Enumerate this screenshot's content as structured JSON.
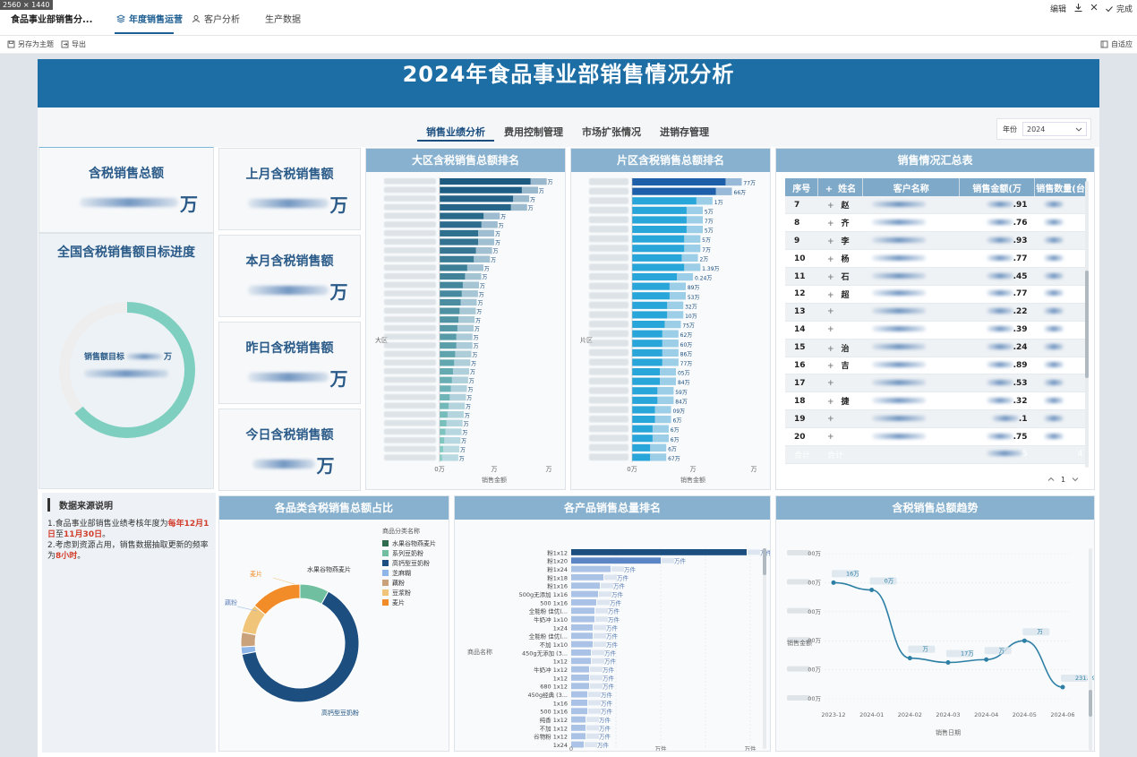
{
  "dim_tag": "2560 × 1440",
  "app_title": "食品事业部销售分...",
  "top_tabs": [
    {
      "label": "年度销售运营",
      "icon": "layers-icon",
      "active": true
    },
    {
      "label": "客户分析",
      "icon": "user-icon",
      "active": false
    },
    {
      "label": "生产数据",
      "icon": "",
      "active": false
    }
  ],
  "top_right": {
    "edit_label": "编辑",
    "finish_label": "完成"
  },
  "toolbar": {
    "save_as_label": "另存为主题",
    "export_label": "导出",
    "fit_label": "自适应"
  },
  "dashboard": {
    "title": "2024年食品事业部销售情况分析",
    "sub_tabs": [
      "销售业绩分析",
      "费用控制管理",
      "市场扩张情况",
      "进销存管理"
    ],
    "active_sub_tab": 0,
    "year_filter": {
      "label": "年份",
      "value": "2024"
    },
    "kpis": {
      "total": {
        "title": "含税销售总额",
        "unit": "万"
      },
      "last_month": {
        "title": "上月含税销售额",
        "unit": "万"
      },
      "this_month": {
        "title": "本月含税销售额",
        "unit": "万"
      },
      "yesterday": {
        "title": "昨日含税销售额",
        "unit": "万"
      },
      "today": {
        "title": "今日含税销售额",
        "unit": "万"
      }
    },
    "target_progress": {
      "title": "全国含税销售额目标进度",
      "center_label": "销售额目标",
      "center_unit": "万",
      "fraction": 0.64
    },
    "data_source": {
      "title": "数据来源说明",
      "line1_a": "1.食品事业部销售业绩考核年度为",
      "line1_b": "每年12月1日",
      "line1_c": "至",
      "line1_d": "11月30日",
      "line1_e": "。",
      "line2_a": "2.考虑到资源占用，销售数据抽取更新的频率为",
      "line2_b": "8小时",
      "line2_c": "。"
    },
    "region_rank": {
      "title": "大区含税销售总额排名",
      "axis_label": "大区",
      "xlabel": "销售金额",
      "tick_first": "0万",
      "tick_mid": "万",
      "tick_last": "万",
      "row_suffix": "大区",
      "value_unit": "万",
      "fractions": [
        0.98,
        0.9,
        0.82,
        0.8,
        0.55,
        0.53,
        0.5,
        0.5,
        0.48,
        0.46,
        0.4,
        0.38,
        0.36,
        0.35,
        0.34,
        0.33,
        0.32,
        0.31,
        0.3,
        0.3,
        0.29,
        0.28,
        0.27,
        0.26,
        0.25,
        0.24,
        0.23,
        0.22,
        0.21,
        0.2,
        0.19,
        0.18,
        0.17
      ]
    },
    "district_rank": {
      "title": "片区含税销售总额排名",
      "axis_label": "片区",
      "xlabel": "销售金额",
      "tick_first": "0万",
      "tick_mid": "万",
      "tick_last": "万",
      "value_labels": [
        "77万",
        "66万",
        "1万",
        "5万",
        "7万",
        "5万",
        "5万",
        "7万",
        "2万",
        "1.39万",
        "0.24万",
        "89万",
        "53万",
        "32万",
        "10万",
        "75万",
        "62万",
        "60万",
        "86万",
        "77万",
        "05万",
        "84万",
        "59万",
        "84万",
        "09万",
        "6万",
        "6万",
        "6万",
        "6万",
        "67万"
      ],
      "fractions": [
        0.9,
        0.82,
        0.66,
        0.58,
        0.58,
        0.58,
        0.56,
        0.56,
        0.54,
        0.56,
        0.5,
        0.44,
        0.44,
        0.42,
        0.42,
        0.4,
        0.38,
        0.38,
        0.38,
        0.38,
        0.36,
        0.36,
        0.34,
        0.34,
        0.32,
        0.32,
        0.3,
        0.3,
        0.28,
        0.28
      ]
    },
    "summary": {
      "title": "销售情况汇总表",
      "headers": [
        "序号",
        "姓名",
        "客户名称",
        "销售金额(万",
        "销售数量(台"
      ],
      "rows": [
        {
          "no": "7",
          "name": "赵",
          "amt": ".91"
        },
        {
          "no": "8",
          "name": "齐",
          "amt": ".76"
        },
        {
          "no": "9",
          "name": "李",
          "amt": ".93"
        },
        {
          "no": "10",
          "name": "杨",
          "amt": ".77"
        },
        {
          "no": "11",
          "name": "石",
          "amt": ".45"
        },
        {
          "no": "12",
          "name": "超",
          "amt": ".77"
        },
        {
          "no": "13",
          "name": "",
          "amt": ".22"
        },
        {
          "no": "14",
          "name": "",
          "amt": ".39"
        },
        {
          "no": "15",
          "name": "治",
          "amt": ".24"
        },
        {
          "no": "16",
          "name": "吉",
          "amt": ".89"
        },
        {
          "no": "17",
          "name": "",
          "amt": ".53"
        },
        {
          "no": "18",
          "name": "捷",
          "amt": ".32"
        },
        {
          "no": "19",
          "name": "",
          "amt": ".1"
        },
        {
          "no": "20",
          "name": "",
          "amt": ".75"
        }
      ],
      "total_label": "合计",
      "total_label2": "合计",
      "total_amt": "5",
      "total_qty": "4",
      "page": "1"
    },
    "category_share": {
      "title": "各品类含税销售总额占比",
      "legend_title": "商品分类名称",
      "legend": [
        "水果谷物燕麦片",
        "系列豆奶粉",
        "高钙型豆奶粉",
        "芝麻糊",
        "藕粉",
        "豆浆粉",
        "麦片"
      ],
      "label_top": "水果谷物燕麦片",
      "label_left": "麦片",
      "label_left2": "藕粉",
      "label_bottom": "高钙型豆奶粉",
      "slices": [
        0.08,
        0.64,
        0.02,
        0.04,
        0.08,
        0.14
      ]
    },
    "product_rank": {
      "title": "各产品销售总量排名",
      "axis_label": "商品名称",
      "xlabel": "销售数量",
      "labels": [
        "粉1x12",
        "粉1x20",
        "粉1x24",
        "粉1x18",
        "粉1x16",
        "500g无添加 1x16",
        "500 1x16",
        "全能粉 佳优(...",
        "牛奶冲 1x10",
        "1x24",
        "全能粉 佳优(...",
        "不加 1x10",
        "450g无添加 (3...",
        "1x12",
        "牛奶冲 1x12",
        "1x12",
        "680 1x12",
        "450g经典 (3...",
        "1x16",
        "500 1x16",
        "纯香 1x12",
        "不加 1x12",
        "谷物粉 1x12",
        "1x24"
      ],
      "values_label": [
        "万件",
        "万件",
        "万件",
        "万件",
        "万件",
        "万件",
        "万件",
        "万件",
        "万件",
        "万件",
        "万件",
        "万件",
        "万件",
        "万件",
        "万件",
        "万件",
        "万件",
        "万件",
        "万件",
        "万件",
        "万件",
        "万件",
        "万件",
        "万件"
      ],
      "fractions": [
        0.98,
        0.5,
        0.22,
        0.18,
        0.16,
        0.15,
        0.14,
        0.13,
        0.13,
        0.12,
        0.12,
        0.12,
        0.11,
        0.11,
        0.1,
        0.1,
        0.1,
        0.09,
        0.09,
        0.09,
        0.08,
        0.08,
        0.08,
        0.07
      ],
      "tick_first": "0",
      "tick_mid": "万件",
      "tick_last": "万件"
    },
    "trend": {
      "title": "含税销售总额趋势",
      "ylabel": "销售金额",
      "xlabel": "销售日期",
      "x": [
        "2023-12",
        "2024-01",
        "2024-02",
        "2024-03",
        "2024-04",
        "2024-05",
        "2024-06"
      ],
      "y_ticks": [
        "00万",
        "00万",
        "00万",
        "00万",
        "00万",
        "00万"
      ],
      "point_labels": [
        "16万",
        "0万",
        "万",
        "17万",
        "万",
        "万",
        "231.39万"
      ],
      "norm_values": [
        0.8,
        0.75,
        0.28,
        0.25,
        0.27,
        0.4,
        0.08
      ]
    }
  },
  "colors": {
    "banner": "#1c6ea4",
    "panel_head": "#87b1cf",
    "accent": "#1c4f80",
    "highlight": "#d23c2a",
    "donut": "#7fcfc0"
  }
}
